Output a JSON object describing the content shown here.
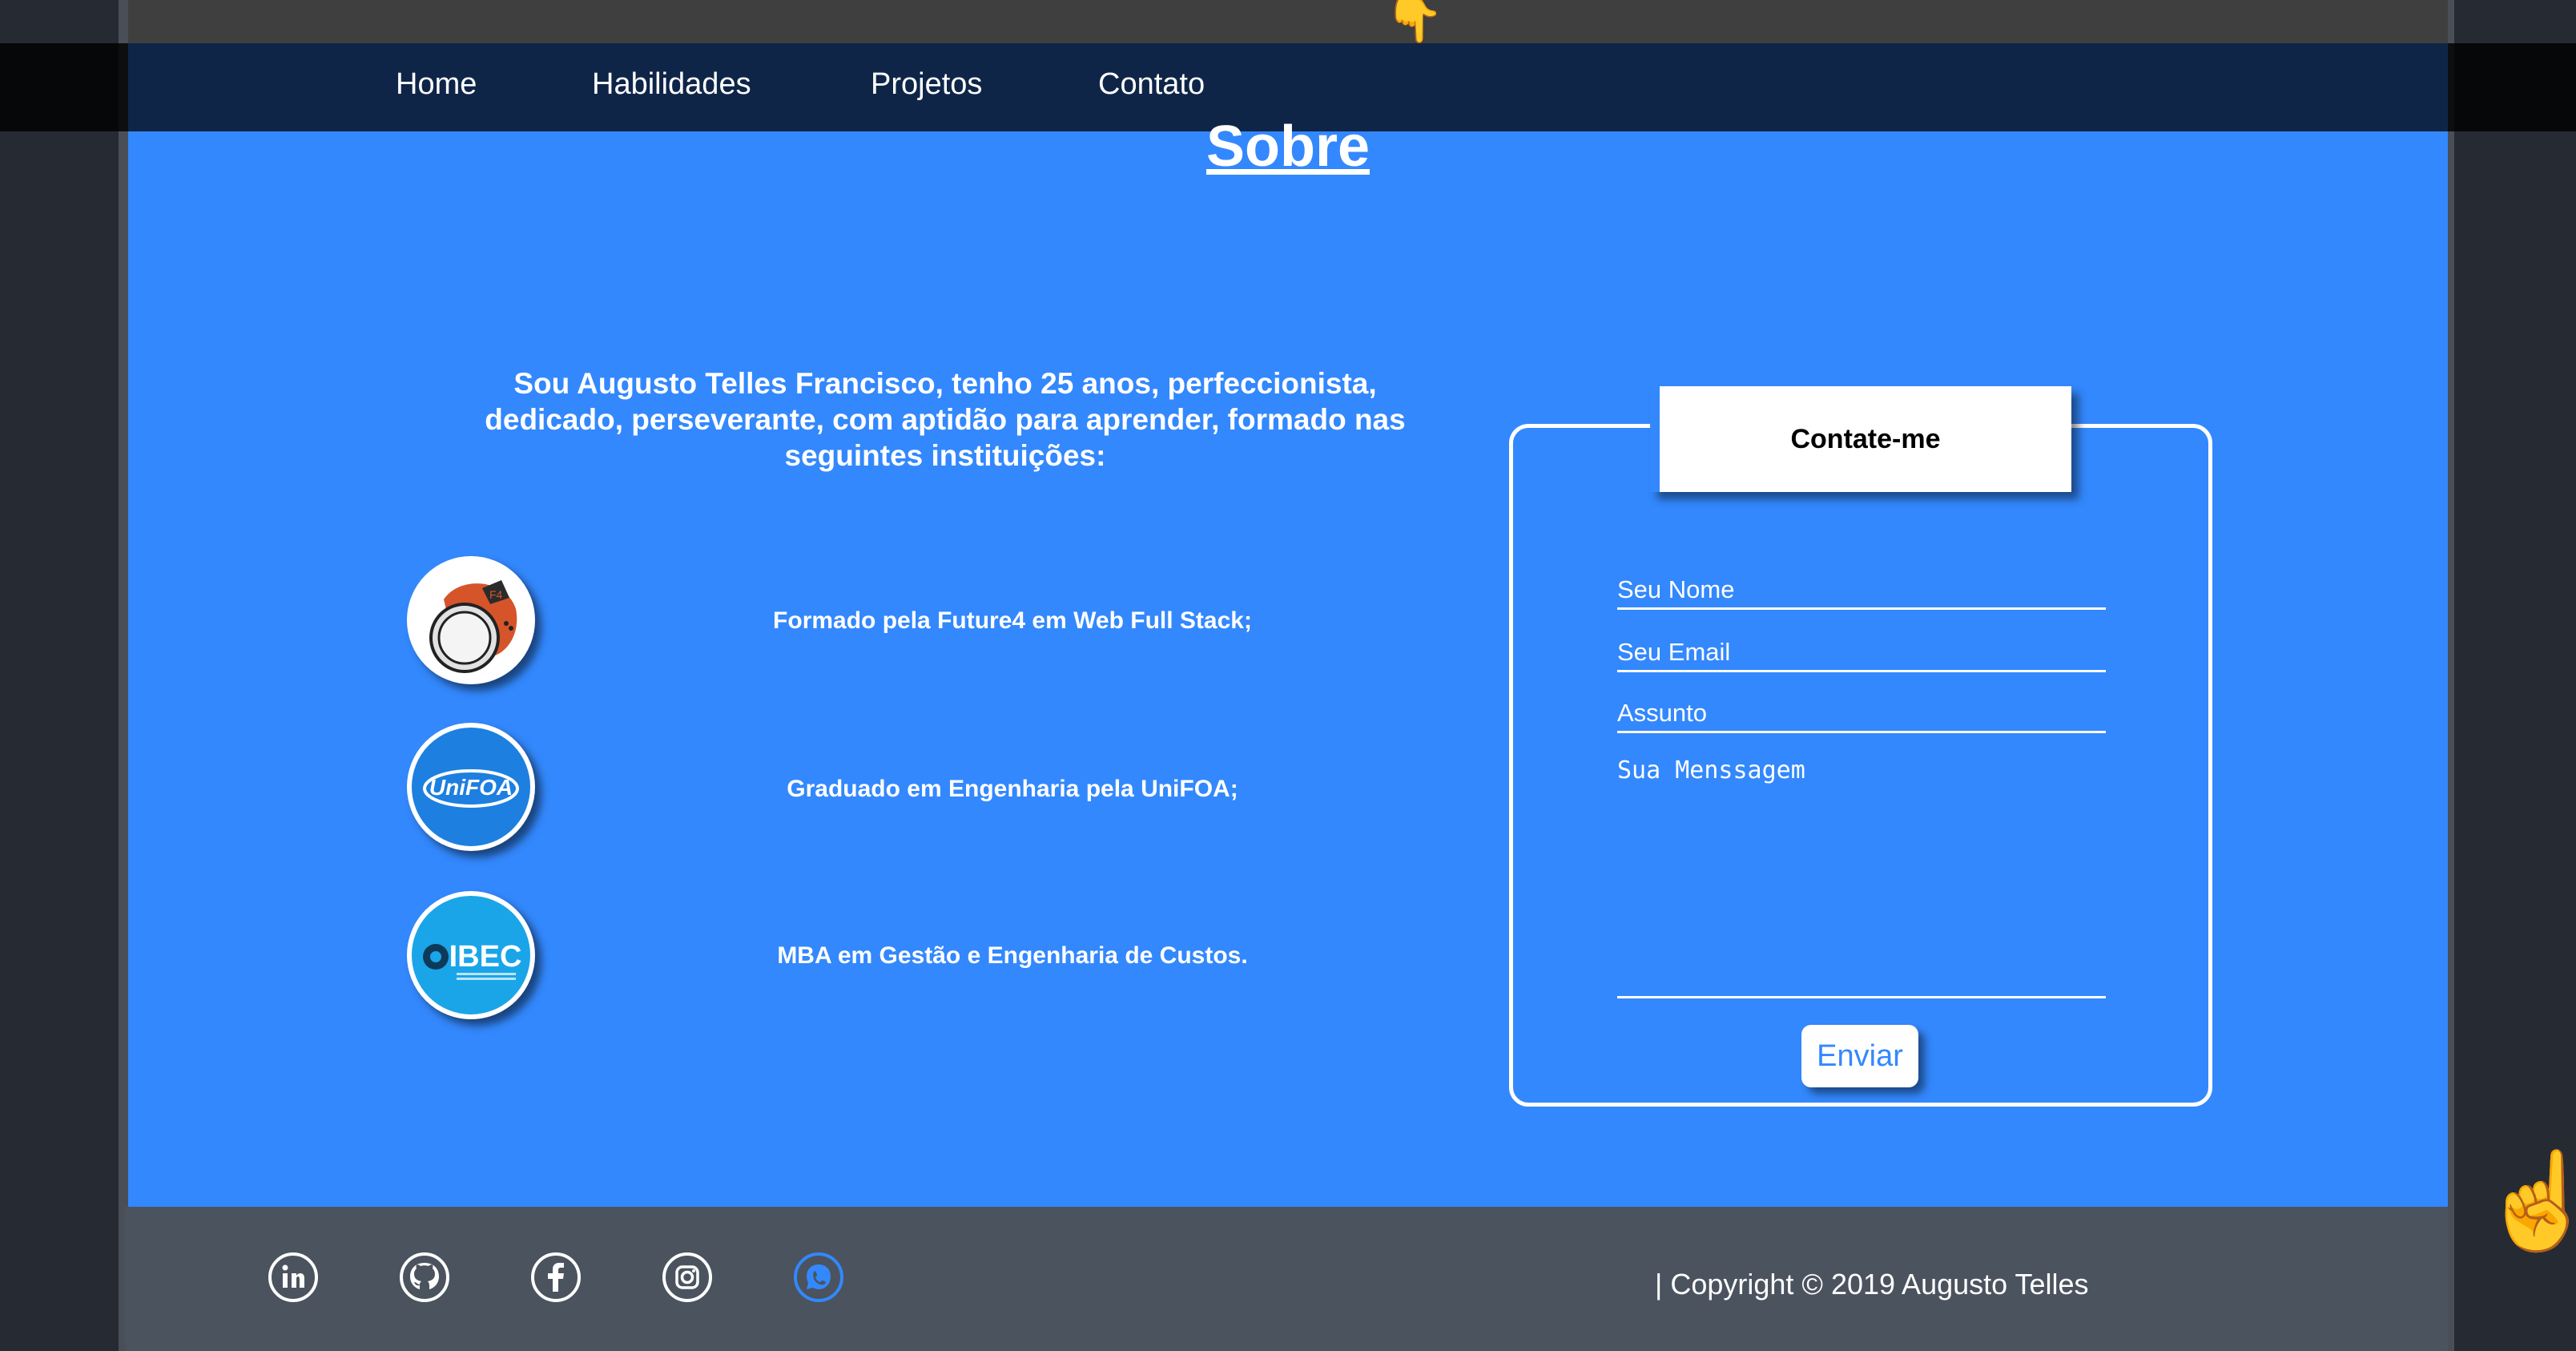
{
  "nav": {
    "items": [
      {
        "label": "Home"
      },
      {
        "label": "Habilidades"
      },
      {
        "label": "Projetos"
      },
      {
        "label": "Contato"
      }
    ]
  },
  "about": {
    "title": "Sobre",
    "intro": "Sou Augusto Telles Francisco, tenho 25 anos, perfeccionista, dedicado, perseverante, com aptidão para aprender, formado nas seguintes instituições:",
    "education": [
      {
        "icon": "future4-astronaut-logo",
        "text": "Formado pela Future4 em Web Full Stack;"
      },
      {
        "icon": "unifoa-logo",
        "logo_text": "UniFOA",
        "text": "Graduado em Engenharia pela UniFOA;"
      },
      {
        "icon": "ibec-logo",
        "logo_text": "IBEC",
        "text": "MBA em Gestão e Engenharia de Custos."
      }
    ]
  },
  "contact": {
    "title": "Contate-me",
    "name_placeholder": "Seu Nome",
    "email_placeholder": "Seu Email",
    "subject_placeholder": "Assunto",
    "message_placeholder": "Sua Menssagem",
    "submit_label": "Enviar"
  },
  "footer": {
    "social": [
      "linkedin-icon",
      "github-icon",
      "facebook-icon",
      "instagram-icon",
      "whatsapp-icon"
    ],
    "copyright": "| Copyright © 2019 Augusto Telles"
  },
  "colors": {
    "section_blue": "#3388fd",
    "navbar": "#0f2548",
    "footer": "#4b535e",
    "whatsapp_accent": "#3388fd"
  }
}
